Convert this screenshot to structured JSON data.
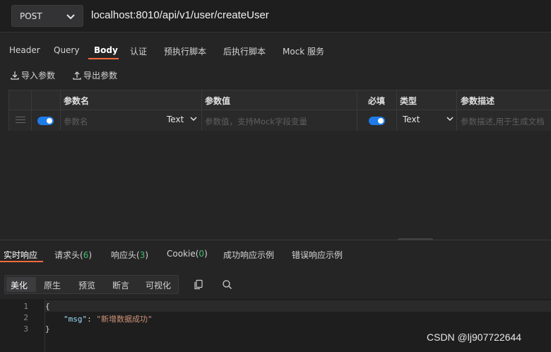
{
  "request": {
    "method": "POST",
    "url": "localhost:8010/api/v1/user/createUser"
  },
  "tabs": [
    "Header",
    "Query",
    "Body",
    "认证",
    "预执行脚本",
    "后执行脚本",
    "Mock 服务"
  ],
  "active_tab": "Body",
  "body": {
    "import_label": "导入参数",
    "export_label": "导出参数",
    "columns": {
      "name": "参数名",
      "value": "参数值",
      "required": "必填",
      "type": "类型",
      "description": "参数描述"
    },
    "row": {
      "enabled": true,
      "name_placeholder": "参数名",
      "value_type": "Text",
      "value_placeholder": "参数值，支持Mock字段变量",
      "required": true,
      "type": "Text",
      "description_placeholder": "参数描述,用于生成文档"
    }
  },
  "response": {
    "tabs": [
      {
        "label": "实时响应"
      },
      {
        "label": "请求头(",
        "count": "6",
        "suffix": ")"
      },
      {
        "label": "响应头(",
        "count": "3",
        "suffix": ")"
      },
      {
        "label": "Cookie(",
        "count": "0",
        "suffix": ")"
      },
      {
        "label": "成功响应示例"
      },
      {
        "label": "错误响应示例"
      }
    ],
    "view_modes": [
      "美化",
      "原生",
      "预览",
      "断言",
      "可视化"
    ],
    "active_view_mode": "美化",
    "code": {
      "line_numbers": [
        "1",
        "2",
        "3"
      ],
      "open_brace": "{",
      "key": "\"msg\"",
      "colon": ": ",
      "value": "\"新增数据成功\"",
      "close_brace": "}"
    }
  },
  "watermark": "CSDN @lj907722644",
  "colors": {
    "accent": "#f26b3a",
    "toggle_on": "#1e7ce8",
    "count_green": "#3fbf6f",
    "json_key": "#9cdcfe",
    "json_string": "#ce9178"
  }
}
